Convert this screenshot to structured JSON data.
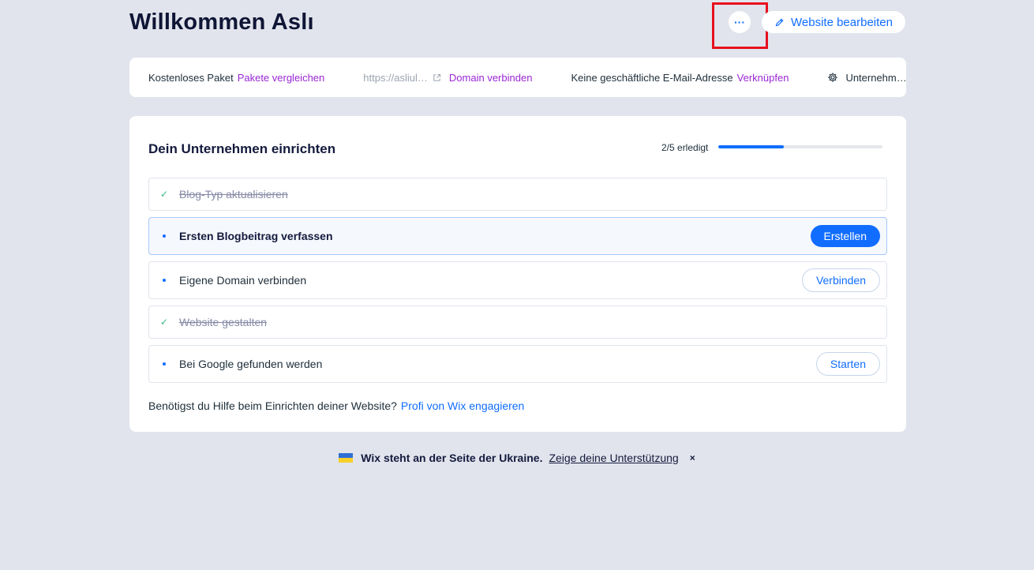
{
  "header": {
    "title": "Willkommen Aslı",
    "more_label": "···",
    "edit_label": "Website bearbeiten"
  },
  "infobar": {
    "plan": "Kostenloses Paket",
    "compare_plans": "Pakete vergleichen",
    "url": "https://asliul…",
    "connect_domain": "Domain verbinden",
    "email_status": "Keine geschäftliche E-Mail-Adresse",
    "email_link": "Verknüpfen",
    "business": "Unternehm…"
  },
  "setup": {
    "title": "Dein Unternehmen einrichten",
    "progress_label": "2/5 erledigt",
    "progress_fraction": 0.4,
    "tasks": [
      {
        "label": "Blog-Typ aktualisieren",
        "done": true,
        "button": ""
      },
      {
        "label": "Ersten Blogbeitrag verfassen",
        "done": false,
        "button": "Erstellen"
      },
      {
        "label": "Eigene Domain verbinden",
        "done": false,
        "button": "Verbinden"
      },
      {
        "label": "Website gestalten",
        "done": true,
        "button": ""
      },
      {
        "label": "Bei Google gefunden werden",
        "done": false,
        "button": "Starten"
      }
    ],
    "help_text": "Benötigst du Hilfe beim Einrichten deiner Website?",
    "help_link": "Profi von Wix engagieren"
  },
  "banner": {
    "text": "Wix steht an der Seite der Ukraine.",
    "link": "Zeige deine Unterstützung",
    "close": "×"
  },
  "colors": {
    "accent": "#116dff",
    "purple_link": "#9a27d5",
    "check": "#38b882",
    "highlight": "#e8101e",
    "background": "#e1e4ec"
  }
}
